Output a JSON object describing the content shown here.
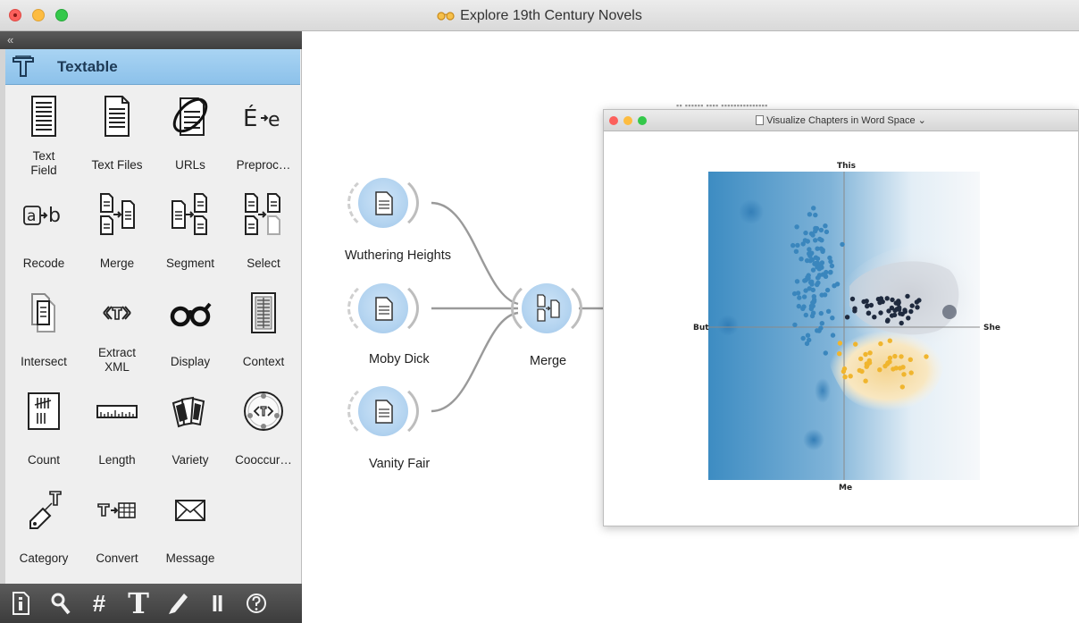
{
  "window": {
    "title": "Explore 19th Century Novels"
  },
  "panel": {
    "collapse_glyph": "«",
    "category": "Textable",
    "widgets": [
      {
        "label": "Text Field",
        "icon": "text-field-icon"
      },
      {
        "label": "Text Files",
        "icon": "text-files-icon"
      },
      {
        "label": "URLs",
        "icon": "urls-icon"
      },
      {
        "label": "Preproc…",
        "icon": "preprocess-icon"
      },
      {
        "label": "Recode",
        "icon": "recode-icon"
      },
      {
        "label": "Merge",
        "icon": "merge-icon"
      },
      {
        "label": "Segment",
        "icon": "segment-icon"
      },
      {
        "label": "Select",
        "icon": "select-icon"
      },
      {
        "label": "Intersect",
        "icon": "intersect-icon"
      },
      {
        "label": "Extract XML",
        "icon": "extract-xml-icon"
      },
      {
        "label": "Display",
        "icon": "display-icon"
      },
      {
        "label": "Context",
        "icon": "context-icon"
      },
      {
        "label": "Count",
        "icon": "count-icon"
      },
      {
        "label": "Length",
        "icon": "length-icon"
      },
      {
        "label": "Variety",
        "icon": "variety-icon"
      },
      {
        "label": "Cooccur…",
        "icon": "cooccurrence-icon"
      },
      {
        "label": "Category",
        "icon": "category-icon"
      },
      {
        "label": "Convert",
        "icon": "convert-icon"
      },
      {
        "label": "Message",
        "icon": "message-icon"
      }
    ],
    "toolbar": [
      "info-icon",
      "search-icon",
      "hash-icon",
      "text-tool-icon",
      "pen-icon",
      "pause-icon",
      "help-icon"
    ],
    "toolbar_text": {
      "hash": "#",
      "text_tool": "T",
      "pause": "II"
    }
  },
  "canvas": {
    "nodes": [
      {
        "id": "wuthering",
        "label": "Wuthering Heights"
      },
      {
        "id": "moby",
        "label": "Moby Dick"
      },
      {
        "id": "vanity",
        "label": "Vanity Fair"
      },
      {
        "id": "merge",
        "label": "Merge"
      }
    ]
  },
  "subwindow": {
    "title": "Visualize Chapters in Word Space",
    "title_chevron": "⌄",
    "ghost_title": "▪▪ ▪▪▪▪▪▪ ▪▪▪▪ ▪▪▪▪▪▪▪▪▪▪▪▪▪▪▪",
    "axes": {
      "top": "This",
      "bottom": "Me",
      "left": "But",
      "right": "She"
    }
  },
  "colors": {
    "blue": "#3a86bd",
    "navy": "#1f2a3e",
    "gold": "#f0b52e",
    "selected": "#8cc1ea",
    "node_fill": "#b4d4f0"
  }
}
